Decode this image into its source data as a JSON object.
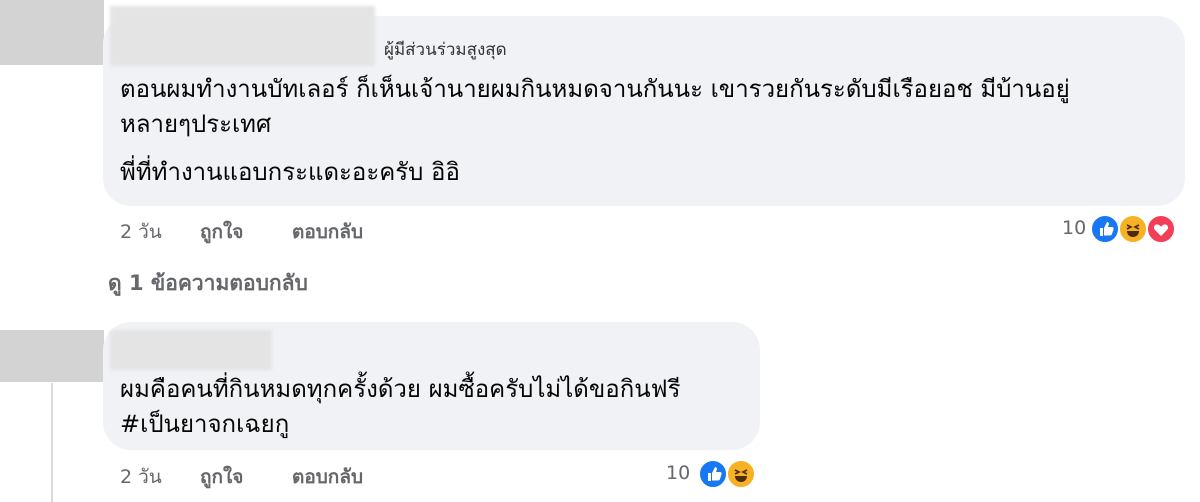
{
  "comments": [
    {
      "badge": "ผู้มีส่วนร่วมสูงสุด",
      "lines": [
        "ตอนผมทำงานบัทเลอร์ ก็เห็นเจ้านายผมกินหมดจานกันนะ เขารวยกันระดับมีเรือยอช มีบ้านอยู่",
        "หลายๆประเทศ",
        "พี่ที่ทำงานแอบกระแดะอะครับ อิอิ"
      ],
      "time": "2 วัน",
      "like": "ถูกใจ",
      "reply": "ตอบกลับ",
      "reaction_count": "10",
      "reactions": [
        "like-icon",
        "haha-icon",
        "love-icon"
      ]
    },
    {
      "lines": [
        "ผมคือคนที่กินหมดทุกครั้งด้วย ผมซื้อครับไม่ได้ขอกินฟรี",
        "#เป็นยาจกเฉยกู"
      ],
      "time": "2 วัน",
      "like": "ถูกใจ",
      "reply": "ตอบกลับ",
      "reaction_count": "10",
      "reactions": [
        "like-icon",
        "haha-icon"
      ]
    }
  ],
  "view_replies": "ดู 1 ข้อความตอบกลับ",
  "colors": {
    "bubble": "#f0f2f5",
    "like_blue": "#1877f2",
    "haha_yellow": "#f7b125",
    "love_red": "#f33e58",
    "meta_gray": "#65676b"
  }
}
